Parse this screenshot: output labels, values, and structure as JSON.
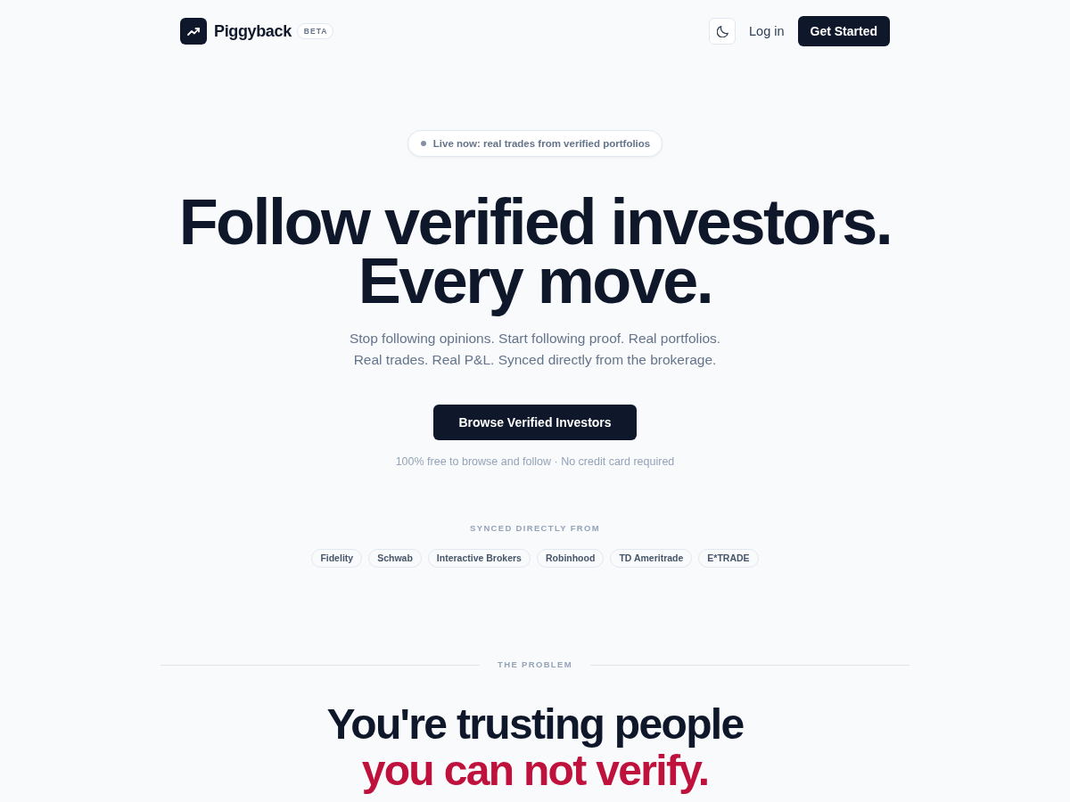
{
  "nav": {
    "brand": "Piggyback",
    "badge": "BETA",
    "login": "Log in",
    "cta": "Get Started"
  },
  "hero": {
    "announcement": "Live now: real trades from verified portfolios",
    "heading_lines": [
      "Follow verified investors.",
      "Every move."
    ],
    "subtitle": "Stop following opinions. Start following proof. Real portfolios. Real trades. Real P&L. Synced directly from the brokerage.",
    "cta": "Browse Verified Investors",
    "note": "100% free to browse and follow · No credit card required"
  },
  "brokers": {
    "label": "SYNCED DIRECTLY FROM",
    "items": [
      "Fidelity",
      "Schwab",
      "Interactive Brokers",
      "Robinhood",
      "TD Ameritrade",
      "E*TRADE"
    ]
  },
  "problem": {
    "label": "THE PROBLEM",
    "heading": "You're trusting people",
    "heading_accent": "you can not verify."
  }
}
